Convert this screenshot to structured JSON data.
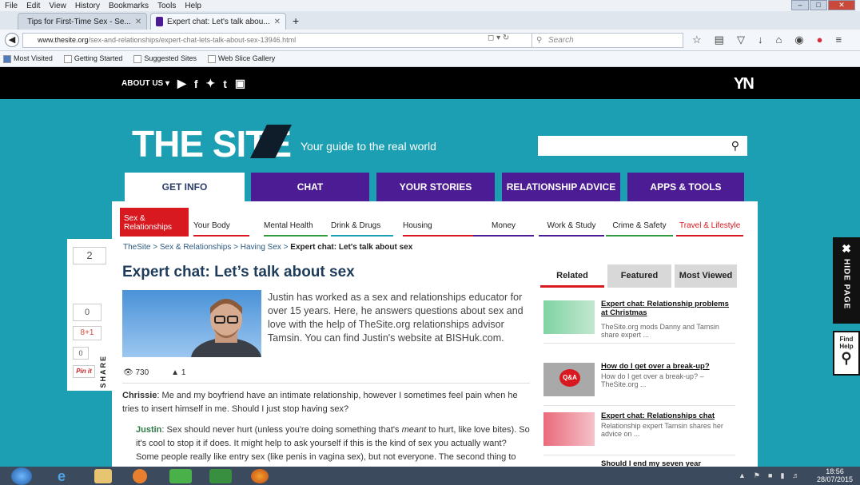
{
  "browser": {
    "menu": [
      "File",
      "Edit",
      "View",
      "History",
      "Bookmarks",
      "Tools",
      "Help"
    ],
    "tabs": [
      {
        "label": "Tips for First-Time Sex - Se...",
        "active": false
      },
      {
        "label": "Expert chat: Let's talk abou...",
        "active": true
      }
    ],
    "new_tab": "+",
    "url_host": "www.thesite.org",
    "url_path": "/sex-and-relationships/expert-chat-lets-talk-about-sex-13946.html",
    "search_placeholder": "Search",
    "bookmarks": [
      "Most Visited",
      "Getting Started",
      "Suggested Sites",
      "Web Slice Gallery"
    ]
  },
  "site": {
    "top_bar": {
      "about": "ABOUT US ▾",
      "logo": "YN"
    },
    "logo": "THE SITE",
    "tagline": "Your guide to the real world",
    "main_tabs": [
      "GET INFO",
      "CHAT",
      "YOUR STORIES",
      "RELATIONSHIP ADVICE",
      "APPS & TOOLS"
    ],
    "sub_tabs": [
      "Sex & Relationships",
      "Your Body",
      "Mental Health",
      "Drink & Drugs",
      "Housing",
      "Money",
      "Work & Study",
      "Crime & Safety",
      "Travel & Lifestyle"
    ],
    "breadcrumb_path": "TheSite > Sex & Relationships > Having Sex > ",
    "breadcrumb_current": "Expert chat: Let's talk about sex",
    "title": "Expert chat: Let’s talk about sex",
    "intro": "Justin has worked as a sex and relationships educator for over 15 years. Here, he answers questions about sex and love with the help of TheSite.org relationships advisor Tamsin. You can find Justin's website at BISHuk.com.",
    "views": "730",
    "likes": "1",
    "question_name": "Chrissie",
    "question": ": Me and my boyfriend have an intimate relationship, however I sometimes feel pain when he tries to insert himself in me. Should I just stop having sex?",
    "answer_name": "Justin",
    "answer_a": ": Sex should never hurt (unless you're doing something that's ",
    "answer_em": "meant",
    "answer_b": " to hurt, like love bites). So it's cool to stop it if does. It might help to ask yourself if this is the kind of sex you actually want? Some people really like entry sex (like penis in vagina sex), but not everyone. The second thing to",
    "side_tabs": [
      "Related",
      "Featured",
      "Most Viewed"
    ],
    "related": [
      {
        "title": "Expert chat: Relationship problems at Christmas",
        "snippet": "TheSite.org mods Danny and Tamsin share expert ..."
      },
      {
        "title": "How do I get over a break-up?",
        "snippet": "How do I get over a break-up? – TheSite.org ..."
      },
      {
        "title": "Expert chat: Relationships chat",
        "snippet": "Relationship expert Tamsin shares her advice on ..."
      },
      {
        "title": "Should I end my seven year",
        "snippet": ""
      }
    ],
    "share": {
      "count_top": "2",
      "fb": "0",
      "gplus": "8+1",
      "li": "0",
      "pin": "Pin it",
      "label": "SHARE"
    },
    "hide_page": "HIDE PAGE",
    "find_help": "Find Help",
    "qa_badge": "Q&A"
  },
  "taskbar": {
    "time": "18:56",
    "date": "28/07/2015"
  },
  "colors": {
    "teal": "#1c9fb2",
    "purple": "#4b1c93",
    "red": "#d8191f",
    "black": "#000000"
  }
}
